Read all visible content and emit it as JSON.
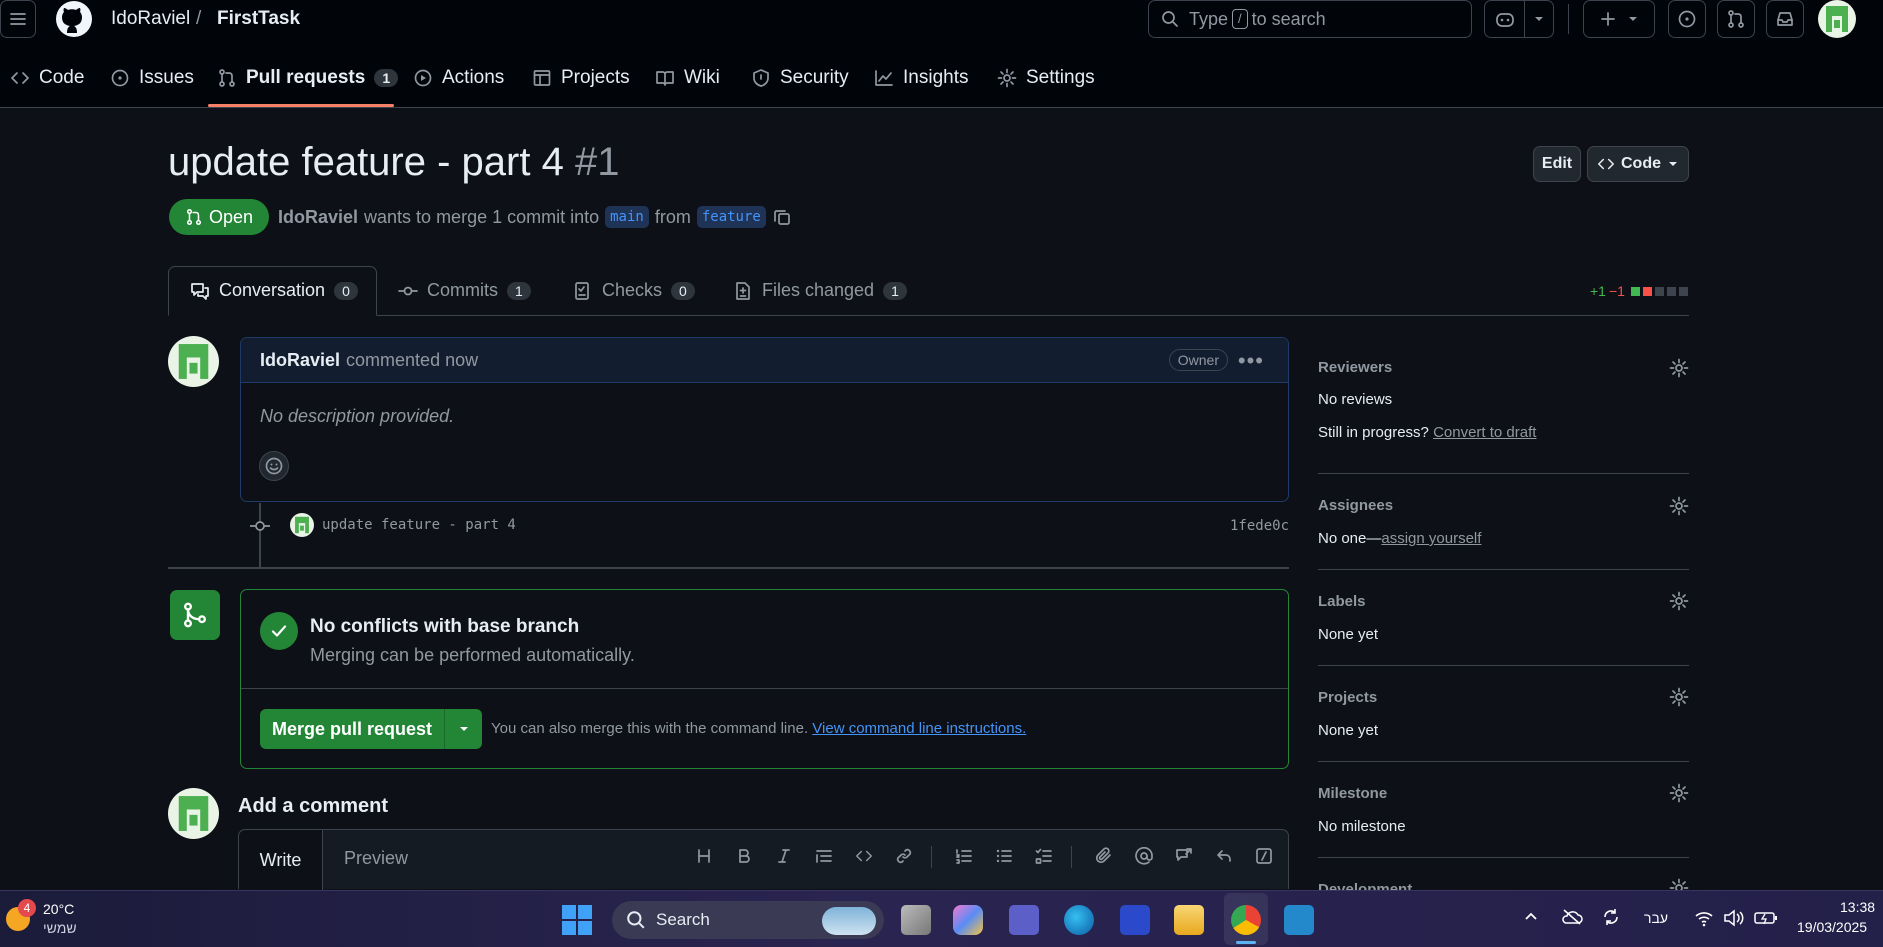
{
  "header": {
    "owner": "IdoRaviel",
    "separator": "/",
    "repo": "FirstTask",
    "search_prefix": "Type",
    "search_key": "/",
    "search_suffix": "to search"
  },
  "repo_nav": {
    "tabs": [
      {
        "label": "Code"
      },
      {
        "label": "Issues"
      },
      {
        "label": "Pull requests",
        "count": "1"
      },
      {
        "label": "Actions"
      },
      {
        "label": "Projects"
      },
      {
        "label": "Wiki"
      },
      {
        "label": "Security"
      },
      {
        "label": "Insights"
      },
      {
        "label": "Settings"
      }
    ]
  },
  "pr": {
    "title": "update feature - part 4",
    "number": "#1",
    "edit_label": "Edit",
    "code_label": "Code",
    "state": "Open",
    "author": "IdoRaviel",
    "meta_text": "wants to merge 1 commit into",
    "base_branch": "main",
    "from_text": "from",
    "head_branch": "feature",
    "tabs": [
      {
        "label": "Conversation",
        "count": "0"
      },
      {
        "label": "Commits",
        "count": "1"
      },
      {
        "label": "Checks",
        "count": "0"
      },
      {
        "label": "Files changed",
        "count": "1"
      }
    ],
    "additions": "+1",
    "deletions": "−1"
  },
  "comment": {
    "author": "IdoRaviel",
    "time": "commented now",
    "role": "Owner",
    "body": "No description provided."
  },
  "commit": {
    "message": "update feature - part 4",
    "sha": "1fede0c"
  },
  "merge": {
    "title": "No conflicts with base branch",
    "subtitle": "Merging can be performed automatically.",
    "button": "Merge pull request",
    "hint": "You can also merge this with the command line.",
    "hint_link": "View command line instructions."
  },
  "add_comment": {
    "title": "Add a comment",
    "write_tab": "Write",
    "preview_tab": "Preview"
  },
  "sidebar": {
    "reviewers": {
      "title": "Reviewers",
      "value": "No reviews",
      "progress_text": "Still in progress?",
      "progress_link": "Convert to draft"
    },
    "assignees": {
      "title": "Assignees",
      "value": "No one—",
      "link": "assign yourself"
    },
    "labels": {
      "title": "Labels",
      "value": "None yet"
    },
    "projects": {
      "title": "Projects",
      "value": "None yet"
    },
    "milestone": {
      "title": "Milestone",
      "value": "No milestone"
    },
    "development": {
      "title": "Development"
    }
  },
  "taskbar": {
    "weather_badge": "4",
    "temperature": "20°C",
    "weather_desc": "שמשי",
    "search": "Search",
    "language": "עבר",
    "time": "13:38",
    "date": "19/03/2025"
  },
  "colors": {
    "accent_green": "#238636",
    "link_blue": "#4493f8",
    "tab_underline": "#f78166",
    "background": "#0d1117"
  }
}
